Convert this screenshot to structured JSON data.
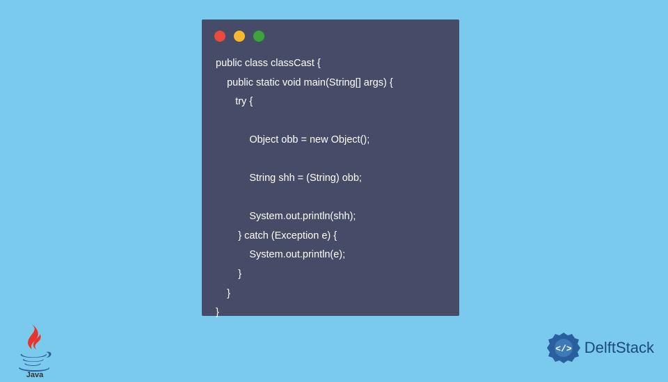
{
  "code": {
    "lines": [
      "public class classCast {",
      "    public static void main(String[] args) {",
      "       try {",
      "",
      "            Object obb = new Object();",
      "",
      "            String shh = (String) obb;",
      "",
      "            System.out.println(shh);",
      "        } catch (Exception e) {",
      "            System.out.println(e);",
      "        }",
      "    }",
      "}"
    ]
  },
  "branding": {
    "delftstack_label": "DelftStack",
    "java_label": "Java"
  },
  "colors": {
    "background": "#7acaed",
    "code_bg": "#464b68",
    "dot_red": "#e94b3c",
    "dot_yellow": "#f5b82e",
    "dot_green": "#3ba53b",
    "delft_blue": "#1a4a7a"
  }
}
